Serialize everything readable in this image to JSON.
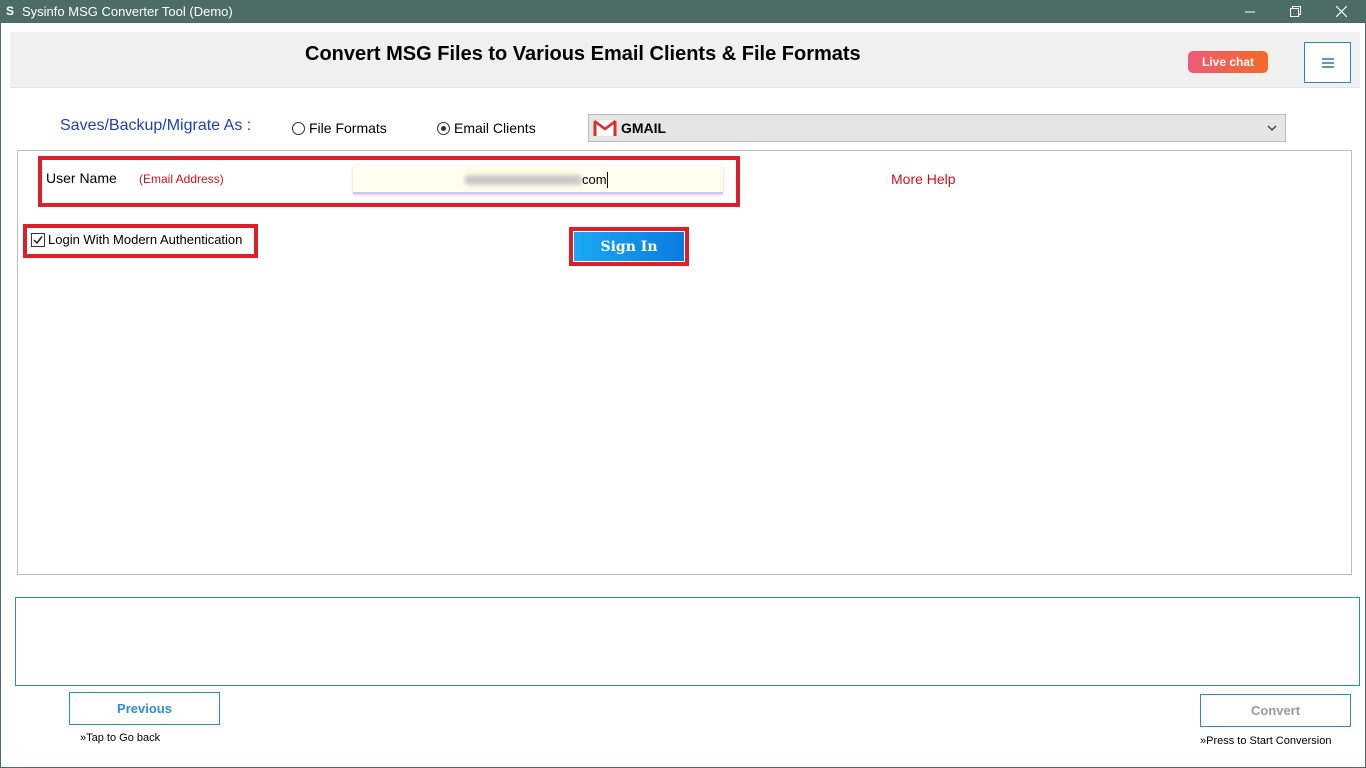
{
  "window": {
    "app_icon": "S",
    "title": "Sysinfo MSG Converter Tool (Demo)",
    "controls": [
      "minimize-icon",
      "restore-icon",
      "close-icon"
    ]
  },
  "header": {
    "title": "Convert MSG Files to Various Email Clients & File Formats",
    "live_chat_label": "Live chat",
    "menu_icon": "hamburger-icon"
  },
  "saves": {
    "label": "Saves/Backup/Migrate As :",
    "options": [
      {
        "label": "File Formats",
        "selected": false
      },
      {
        "label": "Email Clients",
        "selected": true
      }
    ],
    "dropdown": {
      "icon": "gmail-icon",
      "value": "GMAIL"
    }
  },
  "login": {
    "user_label": "User Name",
    "email_hint": "(Email Address)",
    "email_value_suffix": "com",
    "more_help": "More Help",
    "modern_auth_label": "Login With Modern Authentication",
    "modern_auth_checked": true,
    "sign_in_label": "Sign In"
  },
  "footer": {
    "previous_label": "Previous",
    "previous_hint": "»Tap to Go back",
    "convert_label": "Convert",
    "convert_hint": "»Press to Start Conversion"
  },
  "colors": {
    "titlebar": "#4d6d64",
    "highlight": "#dd1f2c",
    "accent_blue": "#1aa8f3",
    "link_red": "#d0101c",
    "label_blue": "#1f3fb8"
  }
}
